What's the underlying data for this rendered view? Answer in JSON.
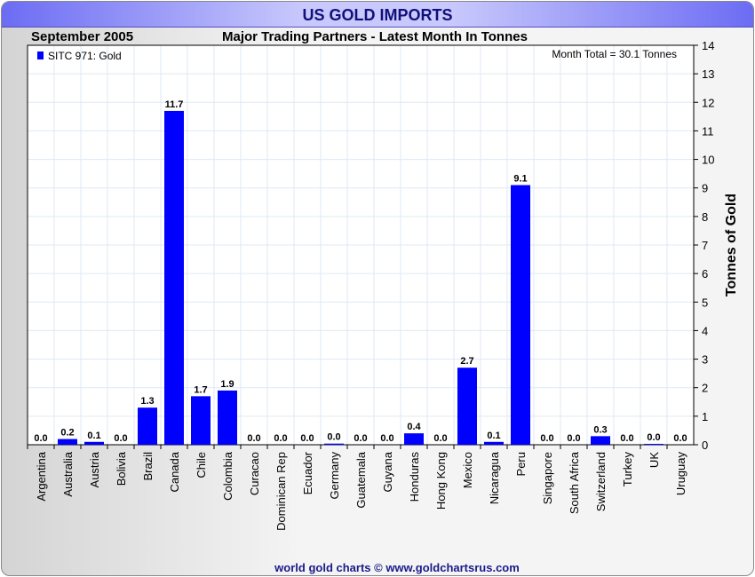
{
  "chart_data": {
    "type": "bar",
    "title": "US GOLD IMPORTS",
    "subtitle": "Major Trading Partners - Latest Month In Tonnes",
    "period": "September 2005",
    "annotation": "Month Total = 30.1 Tonnes",
    "legend": {
      "label": "SITC 971: Gold",
      "placement": "top-left",
      "color": "#0000ff"
    },
    "ylabel": "Tonnes of Gold",
    "xlabel": "",
    "ylim": [
      0,
      14
    ],
    "yticks": [
      0,
      1,
      2,
      3,
      4,
      5,
      6,
      7,
      8,
      9,
      10,
      11,
      12,
      13,
      14
    ],
    "grid": true,
    "categories": [
      "Argentina",
      "Australia",
      "Austria",
      "Bolivia",
      "Brazil",
      "Canada",
      "Chile",
      "Colombia",
      "Curacao",
      "Dominican Rep",
      "Ecuador",
      "Germany",
      "Guatemala",
      "Guyana",
      "Honduras",
      "Hong Kong",
      "Mexico",
      "Nicaragua",
      "Peru",
      "Singapore",
      "South Africa",
      "Switzerland",
      "Turkey",
      "UK",
      "Uruguay"
    ],
    "values": [
      0.0,
      0.2,
      0.1,
      0.0,
      1.3,
      11.7,
      1.7,
      1.9,
      0.0,
      0.0,
      0.0,
      0.04,
      0.0,
      0.0,
      0.4,
      0.0,
      2.7,
      0.1,
      9.1,
      0.0,
      0.0,
      0.3,
      0.0,
      0.03,
      0.0
    ]
  },
  "footer": "world gold charts © www.goldchartsrus.com"
}
